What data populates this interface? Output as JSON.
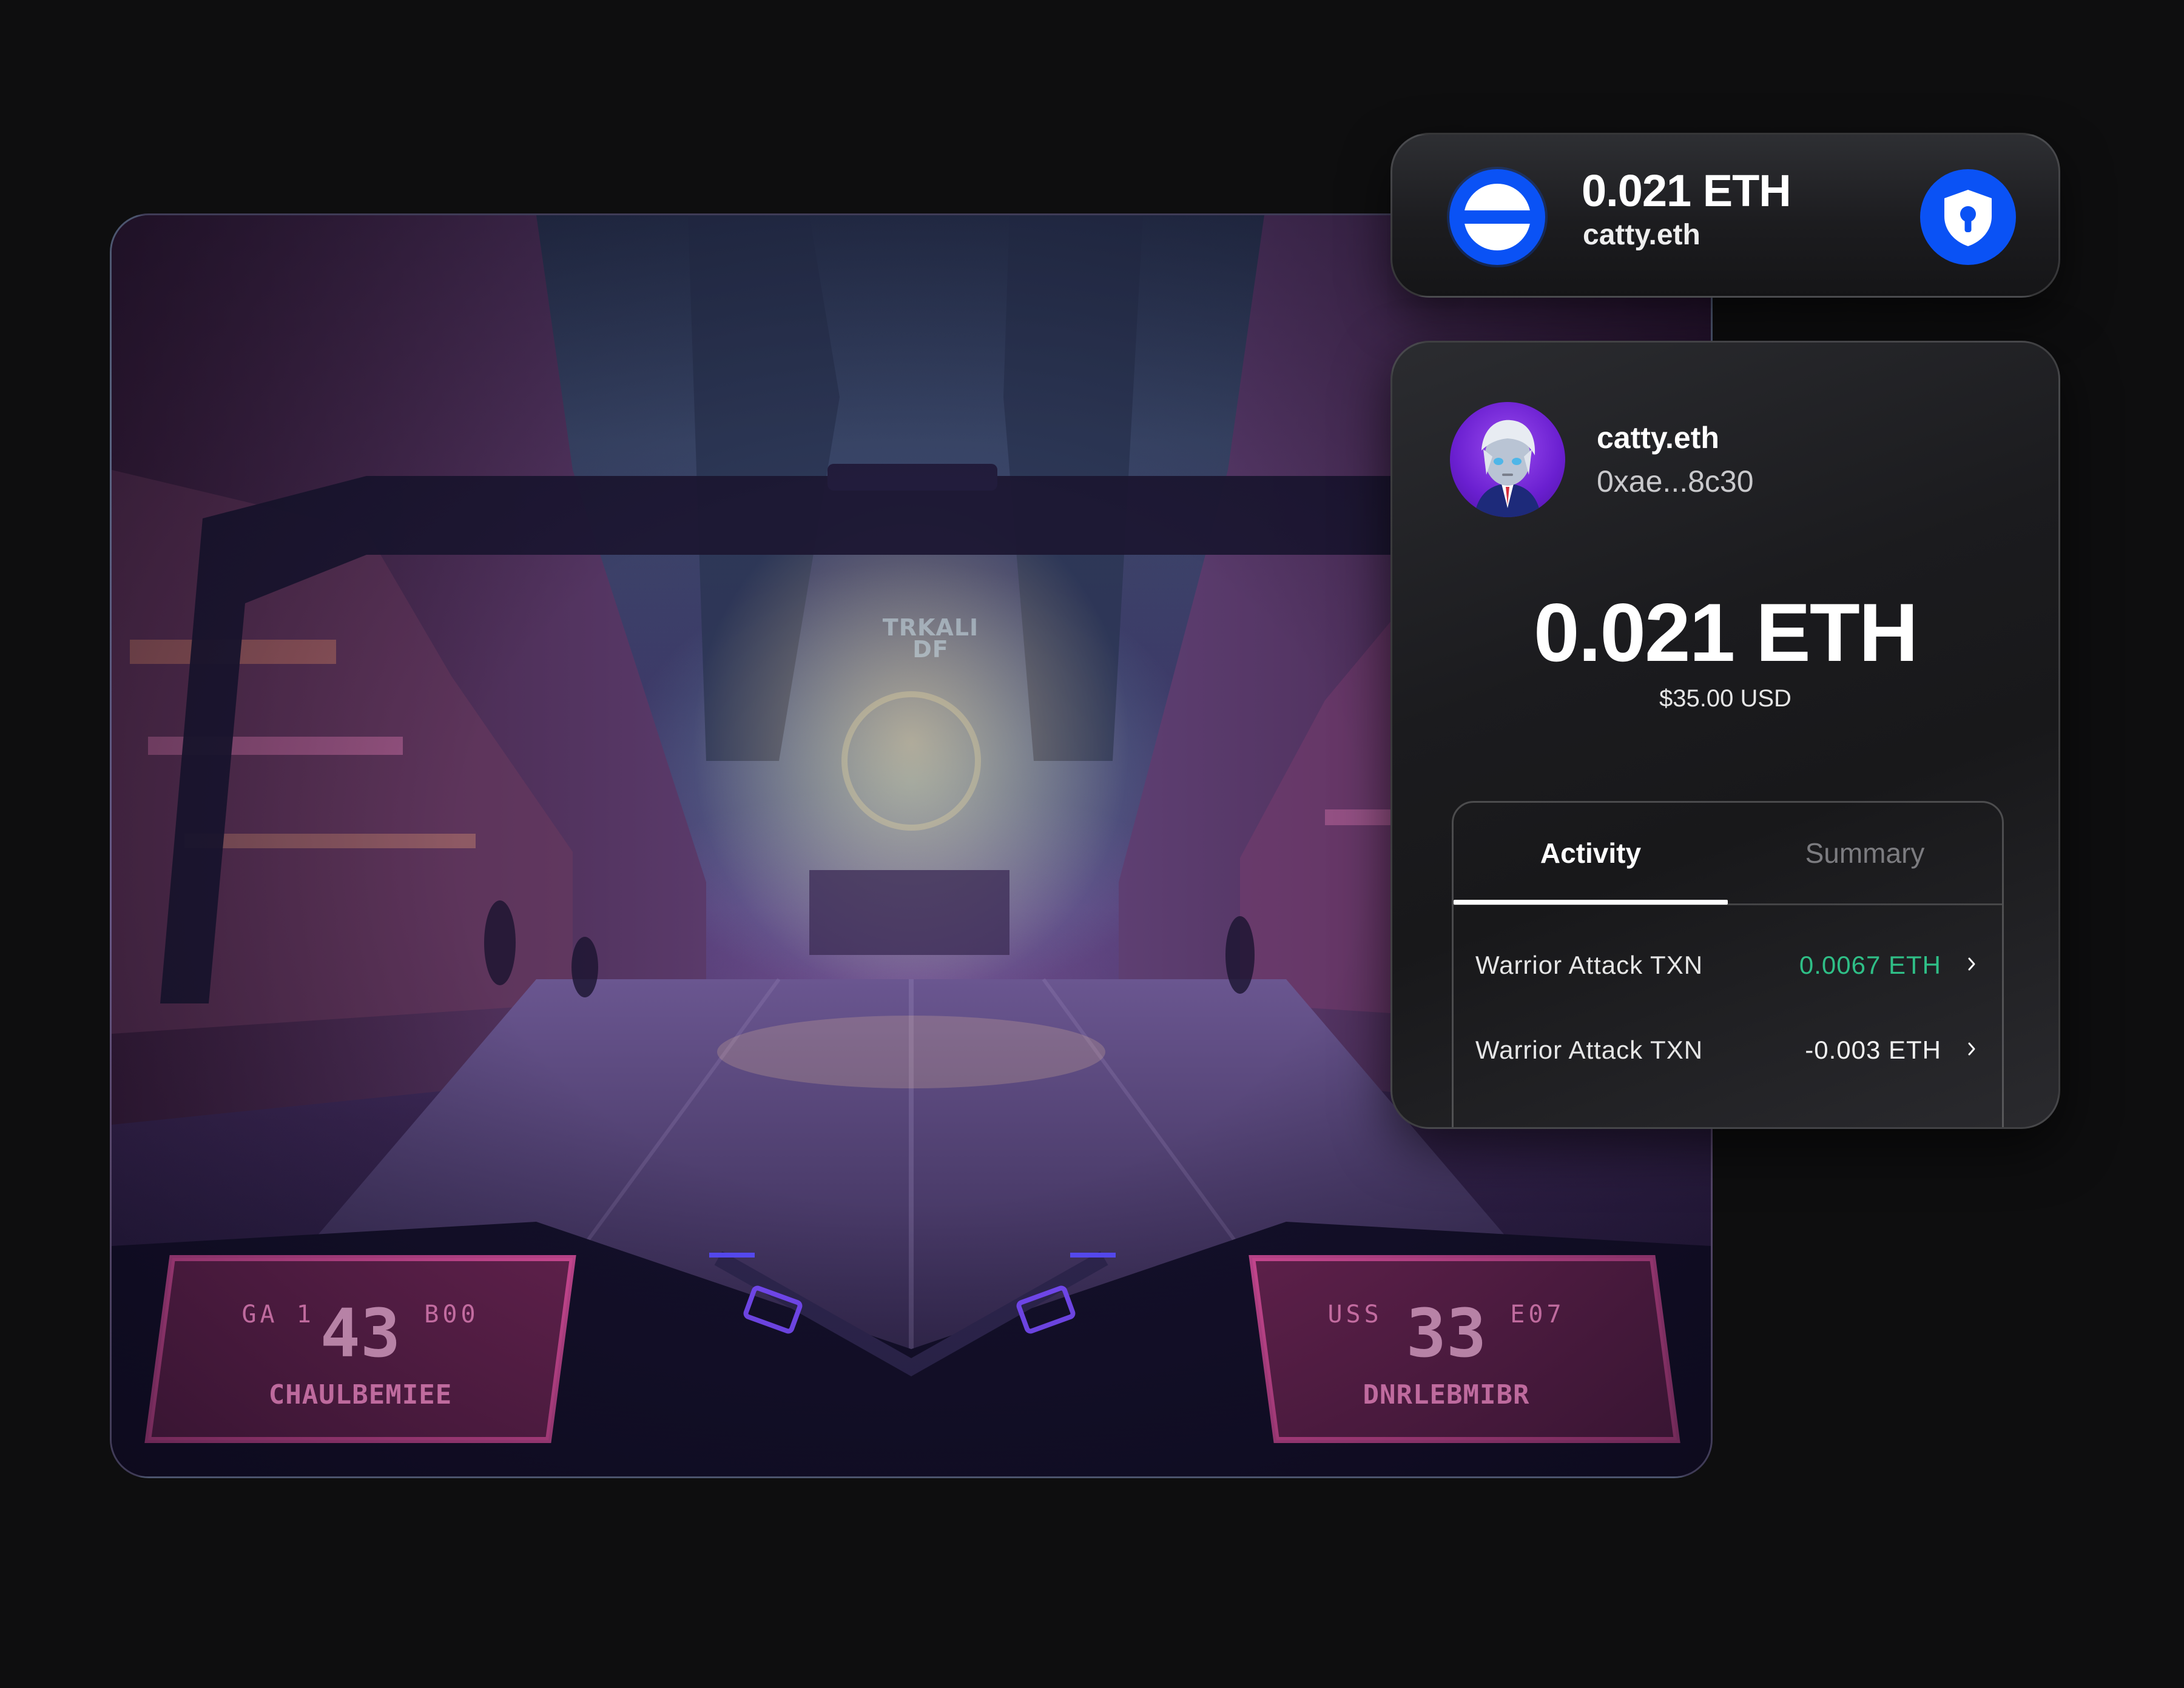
{
  "scene": {
    "sign_text": "TRKALI\nDF",
    "panel_left": {
      "top": "GA 1      B00",
      "number": "43",
      "bottom": "CHAULBEMIEE"
    },
    "panel_right": {
      "top": "USS       E07",
      "number": "33",
      "bottom": "DNRLEBMIBR"
    }
  },
  "pill": {
    "amount": "0.021 ETH",
    "ens": "catty.eth",
    "icons": {
      "logo": "wallet-logo-icon",
      "shield": "shield-lock-icon"
    }
  },
  "card": {
    "ens": "catty.eth",
    "address": "0xae...8c30",
    "balance": "0.021 ETH",
    "balance_usd": "$35.00 USD",
    "tabs": [
      {
        "label": "Activity",
        "active": true
      },
      {
        "label": "Summary",
        "active": false
      }
    ],
    "transactions": [
      {
        "label": "Warrior Attack TXN",
        "amount": "0.0067 ETH",
        "direction": "positive"
      },
      {
        "label": "Warrior Attack TXN",
        "amount": "-0.003 ETH",
        "direction": "negative"
      }
    ]
  },
  "colors": {
    "accent_blue": "#0A52F5",
    "positive_green": "#2FBF87",
    "background": "#0E0E0F"
  }
}
